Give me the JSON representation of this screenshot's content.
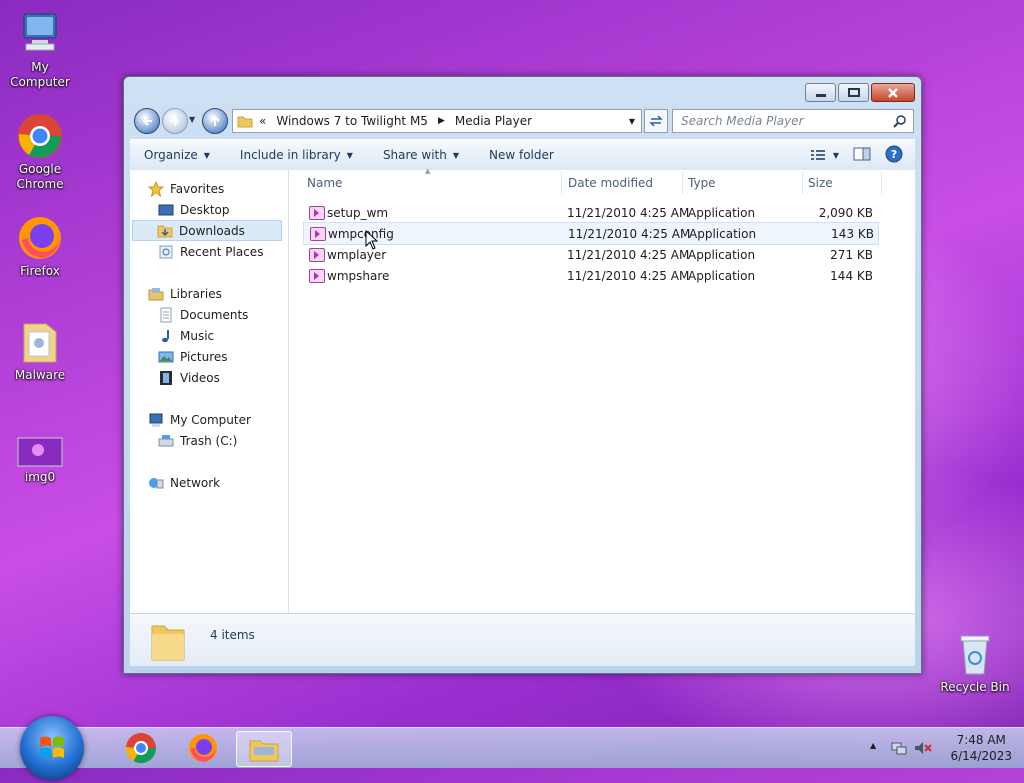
{
  "desktop": {
    "icons": [
      {
        "label": "My Computer"
      },
      {
        "label": "Google Chrome"
      },
      {
        "label": "Firefox"
      },
      {
        "label": "Malware"
      },
      {
        "label": "img0"
      },
      {
        "label": "Recycle Bin"
      }
    ]
  },
  "explorer": {
    "address": {
      "prefix": "«",
      "crumbs": [
        "Windows 7 to Twilight M5",
        "Media Player"
      ]
    },
    "search_placeholder": "Search Media Player",
    "toolbar": {
      "organize": "Organize",
      "include": "Include in library",
      "share": "Share with",
      "new_folder": "New folder"
    },
    "nav": {
      "favorites": "Favorites",
      "desktop": "Desktop",
      "downloads": "Downloads",
      "recent": "Recent Places",
      "libraries": "Libraries",
      "documents": "Documents",
      "music": "Music",
      "pictures": "Pictures",
      "videos": "Videos",
      "computer": "My Computer",
      "trash": "Trash (C:)",
      "network": "Network"
    },
    "columns": {
      "name": "Name",
      "date": "Date modified",
      "type": "Type",
      "size": "Size"
    },
    "files": [
      {
        "name": "setup_wm",
        "date": "11/21/2010 4:25 AM",
        "type": "Application",
        "size": "2,090 KB"
      },
      {
        "name": "wmpconfig",
        "date": "11/21/2010 4:25 AM",
        "type": "Application",
        "size": "143 KB"
      },
      {
        "name": "wmplayer",
        "date": "11/21/2010 4:25 AM",
        "type": "Application",
        "size": "271 KB"
      },
      {
        "name": "wmpshare",
        "date": "11/21/2010 4:25 AM",
        "type": "Application",
        "size": "144 KB"
      }
    ],
    "status": "4 items"
  },
  "taskbar": {
    "time": "7:48 AM",
    "date": "6/14/2023"
  }
}
